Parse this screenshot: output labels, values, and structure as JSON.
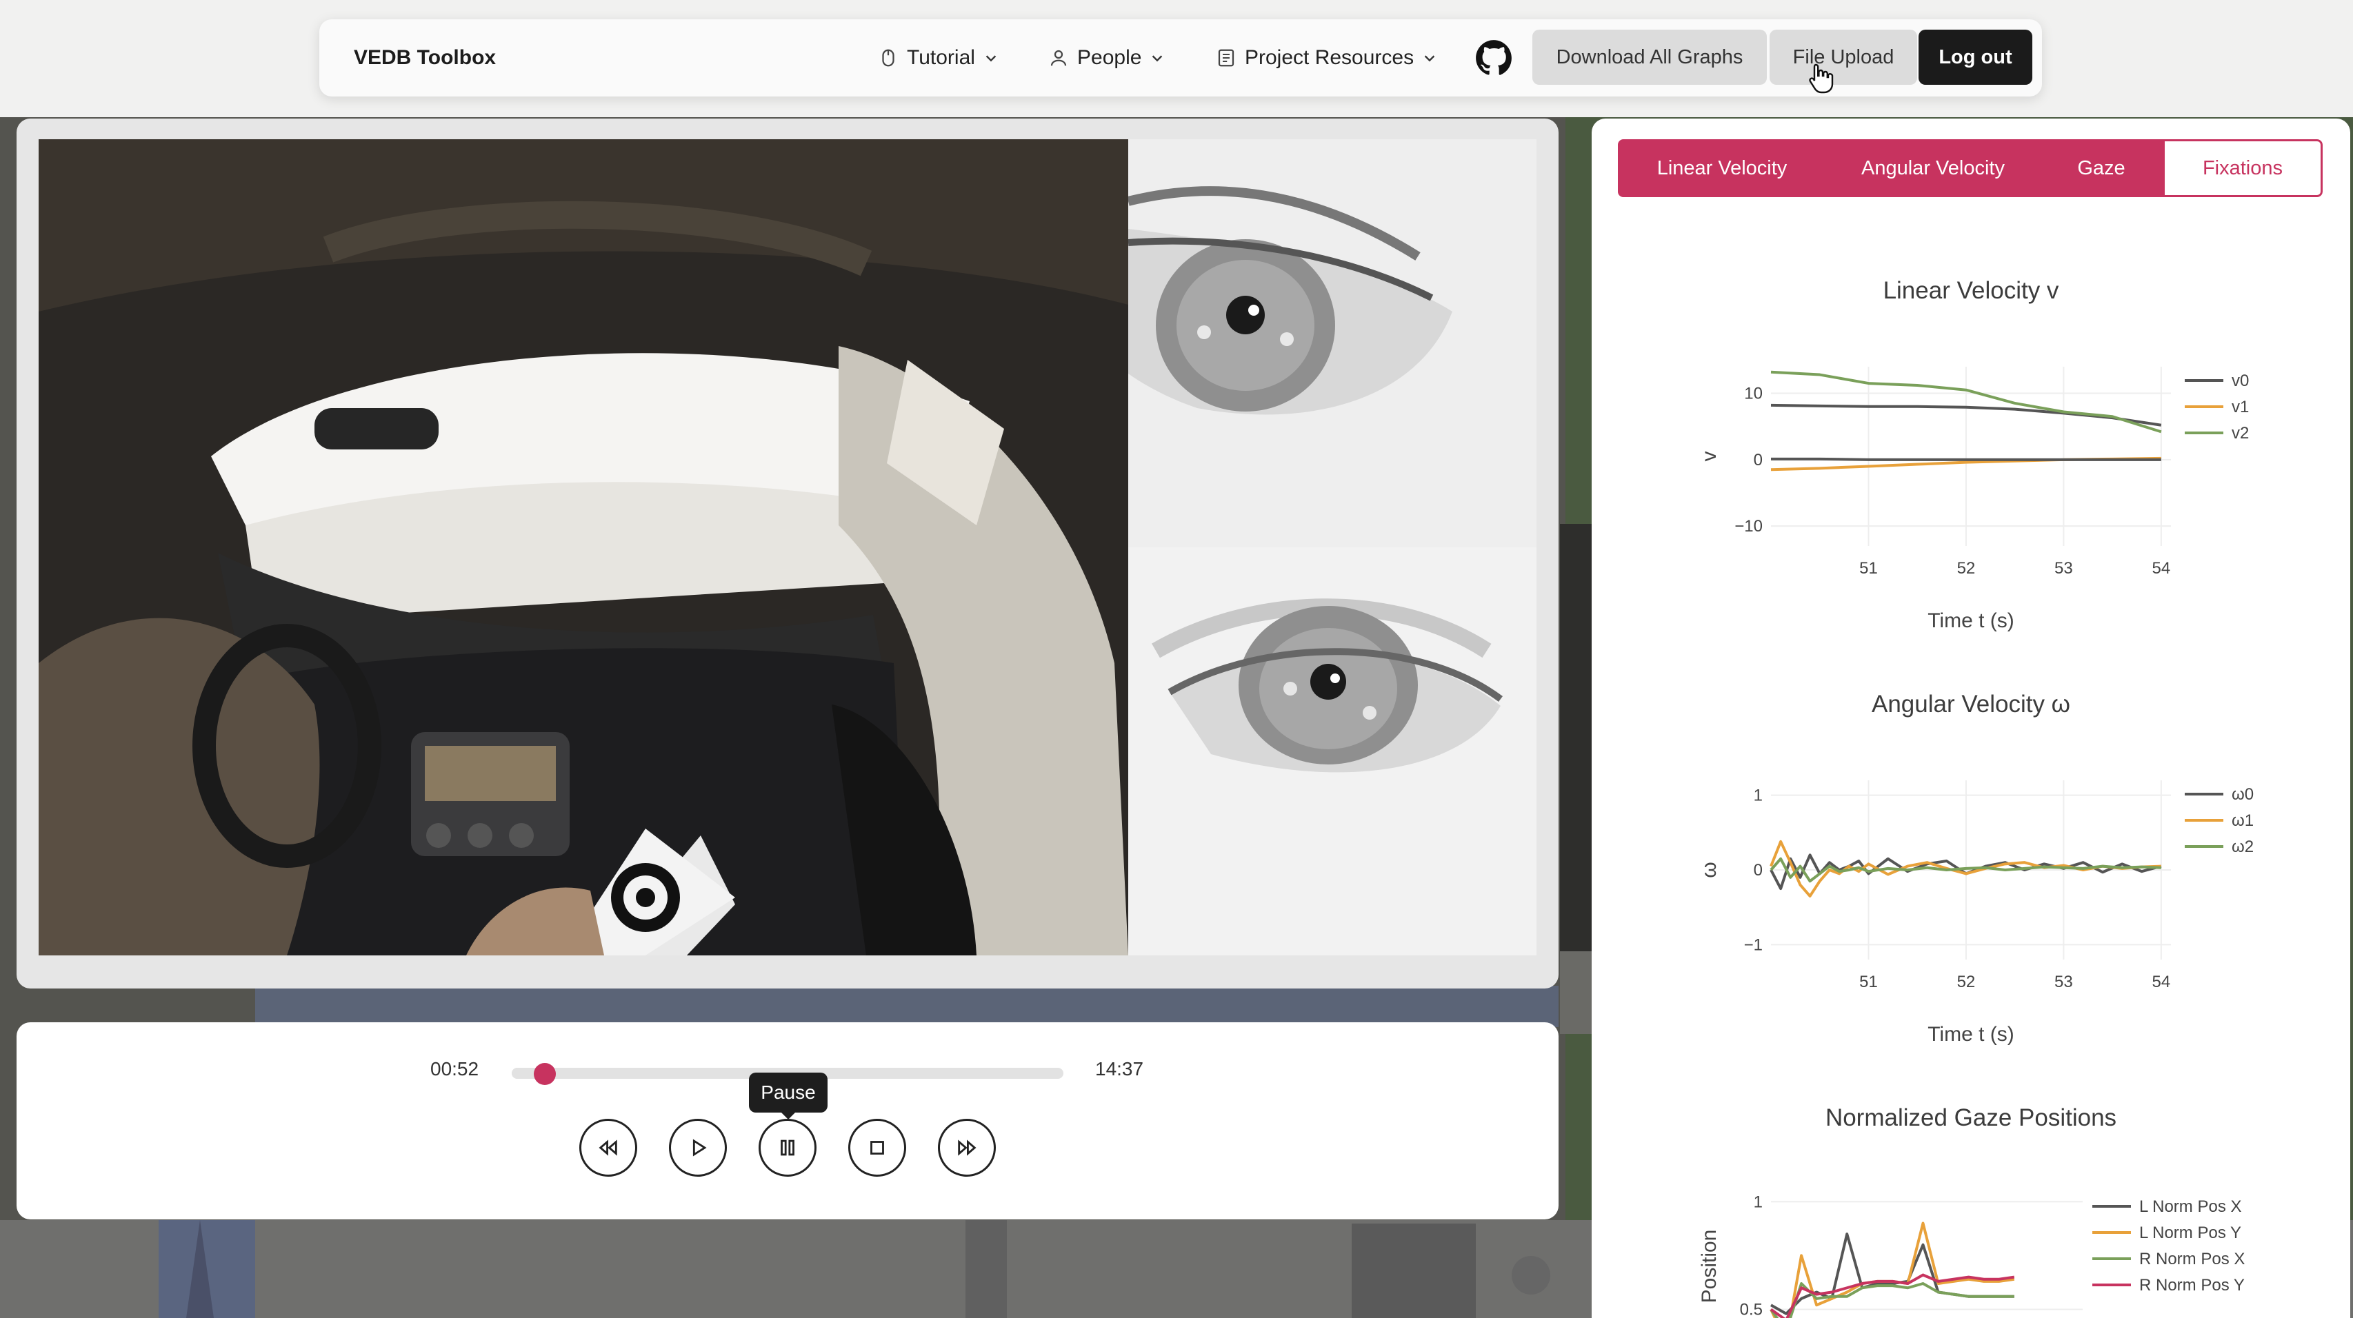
{
  "navbar": {
    "brand": "VEDB Toolbox",
    "menus": [
      {
        "label": "Tutorial",
        "icon": "mouse-icon"
      },
      {
        "label": "People",
        "icon": "person-icon"
      },
      {
        "label": "Project Resources",
        "icon": "document-icon"
      }
    ],
    "github_icon": "github-icon",
    "download_label": "Download All Graphs",
    "upload_label": "File Upload",
    "logout_label": "Log out"
  },
  "player": {
    "current_time": "00:52",
    "total_time": "14:37",
    "progress_fraction": 0.06,
    "tooltip": "Pause",
    "controls": [
      "rewind-icon",
      "play-icon",
      "pause-icon",
      "stop-icon",
      "fast-forward-icon"
    ]
  },
  "tabs": [
    {
      "label": "Linear Velocity",
      "active": false
    },
    {
      "label": "Angular Velocity",
      "active": false
    },
    {
      "label": "Gaze",
      "active": false
    },
    {
      "label": "Fixations",
      "active": true
    }
  ],
  "colors": {
    "accent": "#c7335f",
    "series_0": "#555555",
    "series_1": "#e8a13a",
    "series_2": "#7aa05a",
    "series_3": "#c7335f"
  },
  "chart_data": [
    {
      "type": "line",
      "title": "Linear Velocity v",
      "xlabel": "Time t (s)",
      "ylabel": "v",
      "xlim": [
        50.0,
        54.1
      ],
      "ylim": [
        -13,
        14
      ],
      "xticks": [
        51,
        52,
        53,
        54
      ],
      "yticks": [
        10,
        0,
        -10
      ],
      "ytick_labels": [
        "10",
        "0",
        "−10"
      ],
      "legend": "top-right",
      "x": [
        50.0,
        50.5,
        51.0,
        51.5,
        52.0,
        52.5,
        53.0,
        53.5,
        54.0
      ],
      "series": [
        {
          "name": "v0",
          "color": "#555555",
          "values": [
            8.2,
            8.1,
            8.0,
            8.0,
            7.9,
            7.6,
            7.0,
            6.3,
            5.2
          ]
        },
        {
          "name": "v1",
          "color": "#e8a13a",
          "values": [
            -1.5,
            -1.3,
            -1.0,
            -0.7,
            -0.4,
            -0.2,
            0.0,
            0.1,
            0.2
          ]
        },
        {
          "name": "v2",
          "color": "#7aa05a",
          "values": [
            13.2,
            12.8,
            11.5,
            11.2,
            10.5,
            8.5,
            7.2,
            6.5,
            4.2
          ]
        },
        {
          "name": "",
          "color": "#555555",
          "values": [
            0.1,
            0.1,
            0.0,
            0.0,
            0.0,
            0.0,
            0.0,
            0.0,
            0.0
          ]
        }
      ]
    },
    {
      "type": "line",
      "title": "Angular Velocity ω",
      "xlabel": "Time t (s)",
      "ylabel": "ω",
      "xlim": [
        50.0,
        54.1
      ],
      "ylim": [
        -1.2,
        1.2
      ],
      "xticks": [
        51,
        52,
        53,
        54
      ],
      "yticks": [
        1,
        0,
        -1
      ],
      "ytick_labels": [
        "1",
        "0",
        "−1"
      ],
      "legend": "top-right",
      "x": [
        50.0,
        50.1,
        50.2,
        50.3,
        50.4,
        50.5,
        50.6,
        50.7,
        50.8,
        50.9,
        51.0,
        51.2,
        51.4,
        51.6,
        51.8,
        52.0,
        52.2,
        52.4,
        52.6,
        52.8,
        53.0,
        53.2,
        53.4,
        53.6,
        53.8,
        54.0
      ],
      "series": [
        {
          "name": "ω0",
          "color": "#555555",
          "values": [
            0.0,
            -0.25,
            0.15,
            -0.1,
            0.2,
            -0.05,
            0.1,
            0.0,
            0.05,
            0.12,
            -0.05,
            0.15,
            -0.02,
            0.08,
            0.12,
            -0.05,
            0.05,
            0.1,
            0.0,
            0.08,
            0.02,
            0.1,
            -0.03,
            0.08,
            -0.02,
            0.05
          ]
        },
        {
          "name": "ω1",
          "color": "#e8a13a",
          "values": [
            0.05,
            0.38,
            0.1,
            -0.2,
            -0.35,
            -0.15,
            0.0,
            -0.05,
            0.05,
            -0.02,
            0.08,
            -0.06,
            0.05,
            0.1,
            0.02,
            -0.05,
            0.02,
            0.08,
            0.1,
            0.03,
            0.06,
            0.0,
            0.05,
            0.02,
            0.04,
            0.05
          ]
        },
        {
          "name": "ω2",
          "color": "#7aa05a",
          "values": [
            0.0,
            0.15,
            -0.1,
            0.05,
            -0.15,
            -0.05,
            0.05,
            -0.02,
            0.0,
            0.03,
            -0.02,
            0.02,
            0.0,
            0.03,
            0.0,
            0.02,
            0.03,
            0.0,
            0.02,
            0.04,
            0.03,
            0.02,
            0.05,
            0.03,
            0.04,
            0.03
          ]
        }
      ]
    },
    {
      "type": "line",
      "title": "Normalized Gaze Positions",
      "xlabel": "",
      "ylabel": "Position",
      "xlim": [
        50.0,
        54.1
      ],
      "ylim": [
        0.3,
        1.1
      ],
      "yticks": [
        1,
        0.5
      ],
      "ytick_labels": [
        "1",
        "0.5"
      ],
      "legend": "top-right",
      "x": [
        50.0,
        50.2,
        50.4,
        50.6,
        50.8,
        51.0,
        51.2,
        51.4,
        51.6,
        51.8,
        52.0,
        52.2,
        52.4,
        52.6,
        52.8,
        53.0,
        53.2
      ],
      "series": [
        {
          "name": "L Norm Pos X",
          "color": "#555555",
          "values": [
            0.52,
            0.48,
            0.55,
            0.58,
            0.55,
            0.85,
            0.6,
            0.62,
            0.62,
            0.63,
            0.8,
            0.58,
            0.57,
            0.56,
            0.56,
            0.56,
            0.56
          ]
        },
        {
          "name": "L Norm Pos Y",
          "color": "#e8a13a",
          "values": [
            0.5,
            0.35,
            0.75,
            0.52,
            0.55,
            0.58,
            0.62,
            0.63,
            0.63,
            0.62,
            0.9,
            0.62,
            0.63,
            0.64,
            0.63,
            0.63,
            0.64
          ]
        },
        {
          "name": "R Norm Pos X",
          "color": "#7aa05a",
          "values": [
            0.5,
            0.4,
            0.62,
            0.55,
            0.56,
            0.56,
            0.6,
            0.61,
            0.61,
            0.6,
            0.62,
            0.58,
            0.57,
            0.56,
            0.56,
            0.56,
            0.56
          ]
        },
        {
          "name": "R Norm Pos Y",
          "color": "#c7335f",
          "values": [
            0.5,
            0.45,
            0.6,
            0.57,
            0.58,
            0.6,
            0.62,
            0.63,
            0.63,
            0.62,
            0.66,
            0.63,
            0.64,
            0.65,
            0.64,
            0.64,
            0.65
          ]
        }
      ]
    }
  ]
}
